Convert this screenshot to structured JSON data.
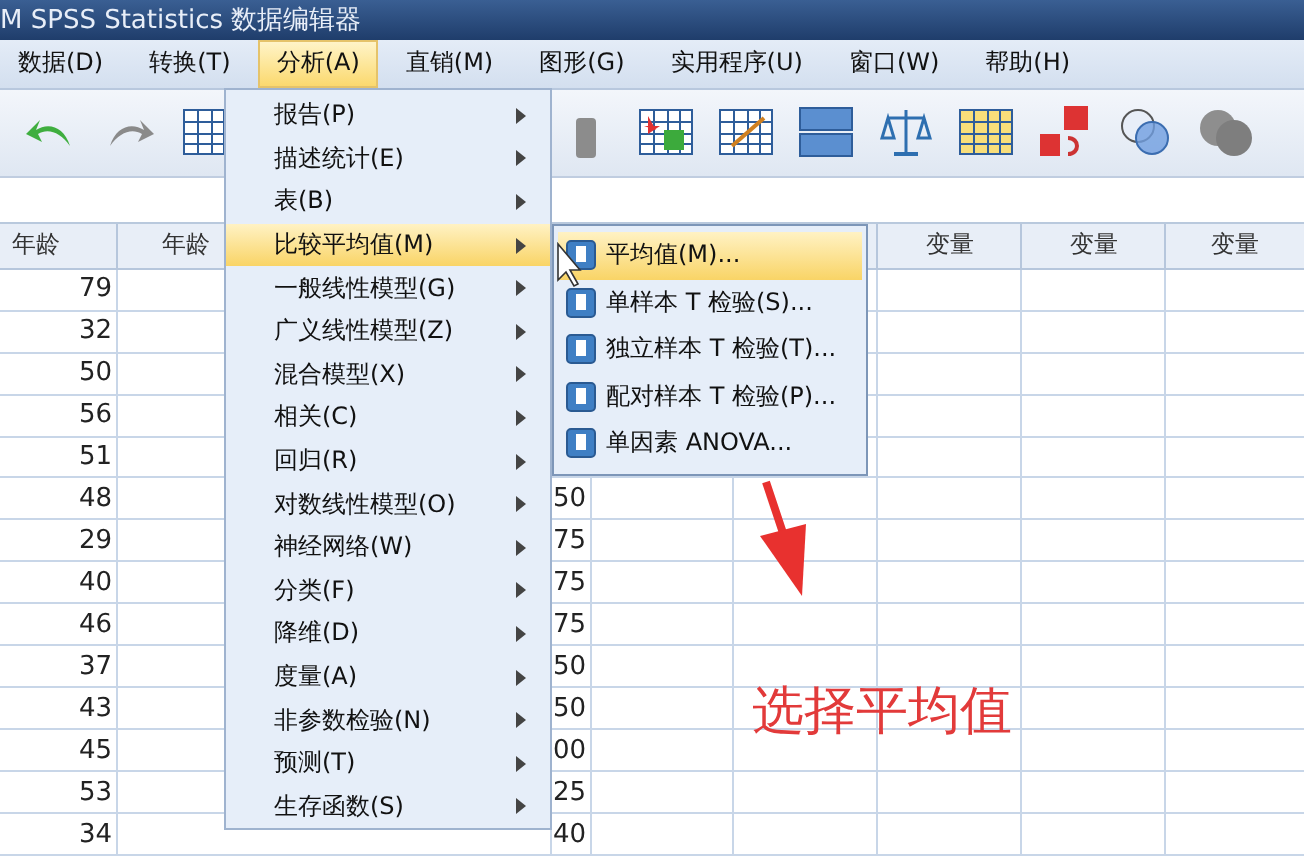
{
  "window": {
    "title": "M SPSS Statistics 数据编辑器"
  },
  "menubar": [
    {
      "label": "数据(D)",
      "selected": false
    },
    {
      "label": "转换(T)",
      "selected": false
    },
    {
      "label": "分析(A)",
      "selected": true
    },
    {
      "label": "直销(M)",
      "selected": false
    },
    {
      "label": "图形(G)",
      "selected": false
    },
    {
      "label": "实用程序(U)",
      "selected": false
    },
    {
      "label": "窗口(W)",
      "selected": false
    },
    {
      "label": "帮助(H)",
      "selected": false
    }
  ],
  "analyze_menu": {
    "items": [
      {
        "label": "报告(P)",
        "selected": false
      },
      {
        "label": "描述统计(E)",
        "selected": false
      },
      {
        "label": "表(B)",
        "selected": false
      },
      {
        "label": "比较平均值(M)",
        "selected": true
      },
      {
        "label": "一般线性模型(G)",
        "selected": false
      },
      {
        "label": "广义线性模型(Z)",
        "selected": false
      },
      {
        "label": "混合模型(X)",
        "selected": false
      },
      {
        "label": "相关(C)",
        "selected": false
      },
      {
        "label": "回归(R)",
        "selected": false
      },
      {
        "label": "对数线性模型(O)",
        "selected": false
      },
      {
        "label": "神经网络(W)",
        "selected": false
      },
      {
        "label": "分类(F)",
        "selected": false
      },
      {
        "label": "降维(D)",
        "selected": false
      },
      {
        "label": "度量(A)",
        "selected": false
      },
      {
        "label": "非参数检验(N)",
        "selected": false
      },
      {
        "label": "预测(T)",
        "selected": false
      },
      {
        "label": "生存函数(S)",
        "selected": false
      }
    ]
  },
  "compare_means_submenu": {
    "items": [
      {
        "label": "平均值(M)...",
        "selected": true
      },
      {
        "label": "单样本 T 检验(S)...",
        "selected": false
      },
      {
        "label": "独立样本 T 检验(T)...",
        "selected": false
      },
      {
        "label": "配对样本 T 检验(P)...",
        "selected": false
      },
      {
        "label": "单因素 ANOVA...",
        "selected": false
      }
    ]
  },
  "grid": {
    "headers": [
      "年龄",
      "年龄"
    ],
    "variable_headers": [
      "变量",
      "变量",
      "变量"
    ],
    "rows": [
      {
        "age": "79"
      },
      {
        "age": "32"
      },
      {
        "age": "50"
      },
      {
        "age": "56"
      },
      {
        "age": "51"
      },
      {
        "age": "48",
        "column_3": "50"
      },
      {
        "age": "29",
        "column_3": "75"
      },
      {
        "age": "40",
        "column_3": "75"
      },
      {
        "age": "46",
        "column_3": "75"
      },
      {
        "age": "37",
        "column_3": "50"
      },
      {
        "age": "43",
        "column_3": "50"
      },
      {
        "age": "45",
        "column_3": "00"
      },
      {
        "age": "53",
        "column_3": "25"
      },
      {
        "age": "34",
        "column_3": "40"
      }
    ]
  },
  "annotation": {
    "text": "选择平均值"
  }
}
